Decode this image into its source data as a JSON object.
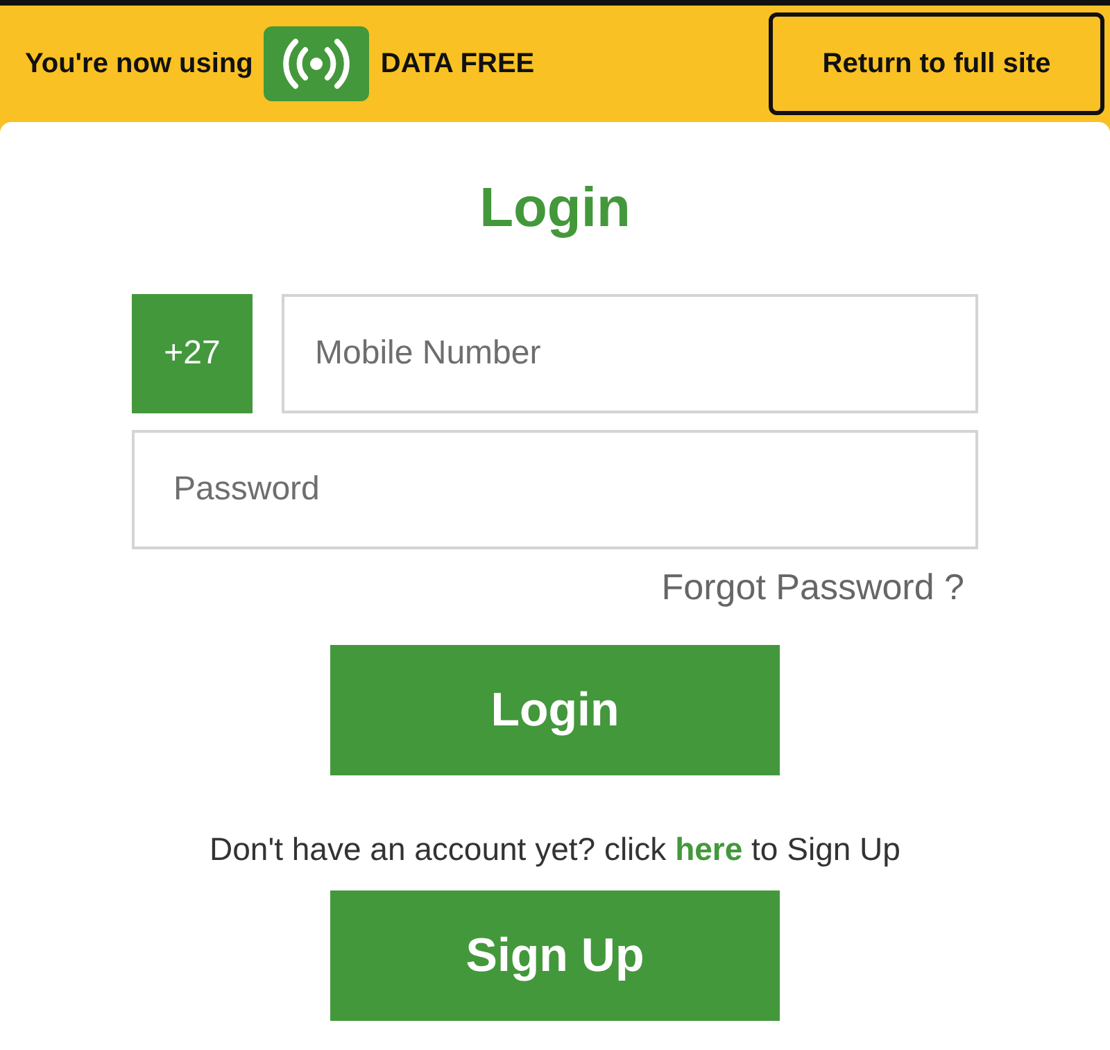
{
  "banner": {
    "text": "You're now using",
    "badge_text": "DATA FREE",
    "return_button": "Return to full site"
  },
  "login_form": {
    "title": "Login",
    "country_code": "+27",
    "mobile": {
      "placeholder": "Mobile Number"
    },
    "password": {
      "placeholder": "Password"
    },
    "forgot_link": "Forgot Password ?",
    "login_button": "Login",
    "signup_prompt": {
      "before": "Don't have an account yet? click",
      "link": "here",
      "after": "to Sign Up"
    },
    "signup_button": "Sign Up"
  }
}
